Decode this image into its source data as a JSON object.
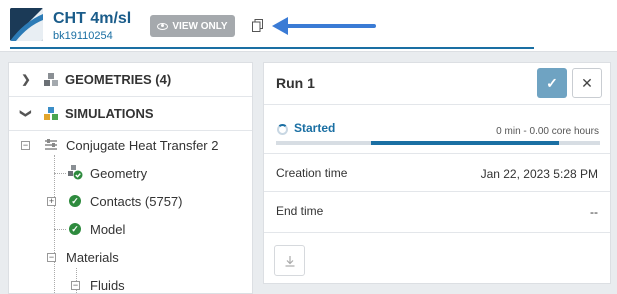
{
  "header": {
    "project_title": "CHT 4m/sl",
    "project_id": "bk19110254",
    "view_only_label": "VIEW ONLY",
    "accent_color": "#1a6fa3",
    "arrow_color": "#3a7bd5"
  },
  "tree": {
    "geometries": {
      "label": "GEOMETRIES (4)",
      "icon": "geometry-cubes-icon"
    },
    "simulations": {
      "label": "SIMULATIONS",
      "icon": "simulation-cubes-icon"
    },
    "simulation_name": "Conjugate Heat Transfer 2",
    "items": [
      {
        "label": "Geometry",
        "icon": "geometry-check-icon"
      },
      {
        "label": "Contacts (5757)",
        "icon": "check-circle-icon"
      },
      {
        "label": "Model",
        "icon": "check-circle-icon"
      },
      {
        "label": "Materials"
      },
      {
        "label": "Fluids"
      }
    ]
  },
  "run": {
    "title": "Run 1",
    "status": "Started",
    "core_hours": "0 min - 0.00 core hours",
    "progress": 0.58,
    "creation_label": "Creation time",
    "creation_value": "Jan 22, 2023 5:28 PM",
    "end_label": "End time",
    "end_value": "--"
  }
}
